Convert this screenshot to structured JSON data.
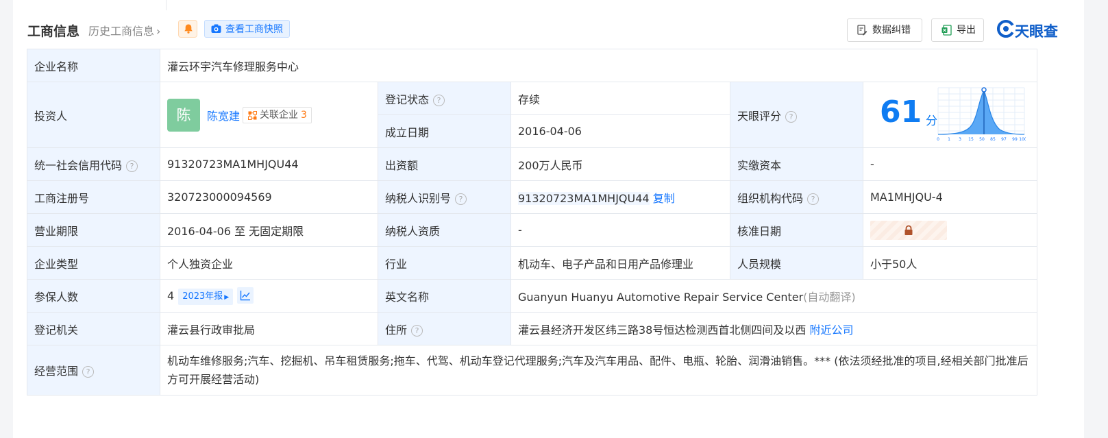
{
  "header": {
    "title": "工商信息",
    "history": "历史工商信息",
    "snapshot_label": "查看工商快照",
    "fix_label": "数据纠错",
    "export_label": "导出",
    "logo_text": "天眼查"
  },
  "rows": {
    "company_name": {
      "label": "企业名称",
      "value": "灌云环宇汽车修理服务中心"
    },
    "investor": {
      "label": "投资人",
      "avatar": "陈",
      "name": "陈宽建",
      "related_label": "关联企业",
      "related_count": "3"
    },
    "reg_status": {
      "label": "登记状态",
      "value": "存续"
    },
    "founded": {
      "label": "成立日期",
      "value": "2016-04-06"
    },
    "score": {
      "label": "天眼评分",
      "value": "61",
      "unit": "分",
      "ticks": [
        "0",
        "1",
        "3",
        "15",
        "50",
        "85",
        "97",
        "99",
        "100"
      ]
    },
    "credit_code": {
      "label": "统一社会信用代码",
      "value": "91320723MA1MHJQU44"
    },
    "capital": {
      "label": "出资额",
      "value": "200万人民币"
    },
    "paid_capital": {
      "label": "实缴资本",
      "value": "-"
    },
    "reg_no": {
      "label": "工商注册号",
      "value": "320723000094569"
    },
    "tax_id": {
      "label": "纳税人识别号",
      "value": "91320723MA1MHJQU44",
      "copy": "复制"
    },
    "org_code": {
      "label": "组织机构代码",
      "value": "MA1MHJQU-4"
    },
    "term": {
      "label": "营业期限",
      "value": "2016-04-06 至 无固定期限"
    },
    "tax_qual": {
      "label": "纳税人资质",
      "value": "-"
    },
    "approve_date": {
      "label": "核准日期"
    },
    "type": {
      "label": "企业类型",
      "value": "个人独资企业"
    },
    "industry": {
      "label": "行业",
      "value": "机动车、电子产品和日用产品修理业"
    },
    "staff": {
      "label": "人员规模",
      "value": "小于50人"
    },
    "insured": {
      "label": "参保人数",
      "value": "4",
      "report": "2023年报"
    },
    "en_name": {
      "label": "英文名称",
      "value": "Guanyun Huanyu Automotive Repair Service Center",
      "note": "(自动翻译)"
    },
    "authority": {
      "label": "登记机关",
      "value": "灌云县行政审批局"
    },
    "address": {
      "label": "住所",
      "value": "灌云县经济开发区纬三路38号恒达检测西首北侧四间及以西",
      "nearby": "附近公司"
    },
    "scope": {
      "label": "经营范围",
      "value": "机动车维修服务;汽车、挖掘机、吊车租赁服务;拖车、代驾、机动车登记代理服务;汽车及汽车用品、配件、电瓶、轮胎、润滑油销售。*** (依法须经批准的项目,经相关部门批准后方可开展经营活动)"
    }
  },
  "colors": {
    "accent": "#1677ff",
    "status_green": "#17a05e",
    "label_bg": "#eef5ff",
    "score_blue": "#0f7cf2"
  }
}
